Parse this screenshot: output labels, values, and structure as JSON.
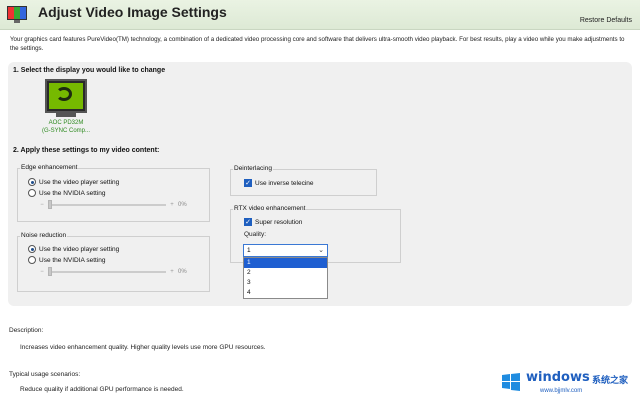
{
  "header": {
    "title": "Adjust Video Image Settings",
    "restore_defaults": "Restore Defaults"
  },
  "intro": "Your graphics card features PureVideo(TM) technology, a combination of a dedicated video processing core and software that delivers ultra-smooth video playback. For best results, play a video while you make adjustments to the settings.",
  "section1": {
    "title": "1. Select the display you would like to change",
    "display_name_line1": "AOC PD32M",
    "display_name_line2": "(G-SYNC Comp..."
  },
  "section2": {
    "title": "2. Apply these settings to my video content:"
  },
  "edge": {
    "label": "Edge enhancement",
    "option1": "Use the video player setting",
    "option2": "Use the NVIDIA setting",
    "value": "0%",
    "minus": "−",
    "plus": "+"
  },
  "noise": {
    "label": "Noise reduction",
    "option1": "Use the video player setting",
    "option2": "Use the NVIDIA setting",
    "value": "0%",
    "minus": "−",
    "plus": "+"
  },
  "deinterlacing": {
    "label": "Deinterlacing",
    "checkbox": "Use inverse telecine"
  },
  "rtx": {
    "label": "RTX video enhancement",
    "checkbox": "Super resolution",
    "quality_label": "Quality:",
    "selected": "1",
    "options": [
      "1",
      "2",
      "3",
      "4"
    ]
  },
  "description": {
    "label": "Description:",
    "text": "Increases video enhancement quality.  Higher quality levels use more GPU resources."
  },
  "usage": {
    "label": "Typical usage scenarios:",
    "text": "Reduce quality if additional GPU performance is needed."
  },
  "watermark": {
    "brand": "windows",
    "sub": "系统之家",
    "url": "www.bjjmlv.com"
  },
  "colors": {
    "accent": "#1f5fbf",
    "nvidia_green": "#76b900"
  }
}
